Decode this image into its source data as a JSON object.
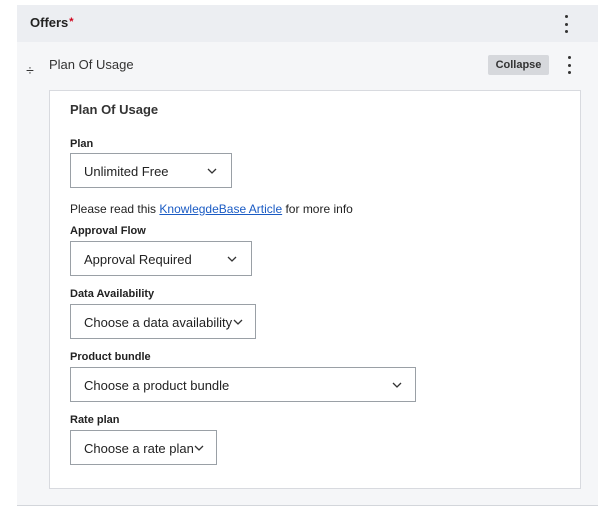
{
  "offers": {
    "title": "Offers",
    "required_mark": "*"
  },
  "item": {
    "header_label": "Plan Of Usage",
    "collapse_label": "Collapse"
  },
  "card": {
    "title": "Plan Of Usage",
    "plan": {
      "label": "Plan",
      "value": "Unlimited Free"
    },
    "info": {
      "prefix": "Please read this ",
      "link": "KnowlegdeBase Article",
      "suffix": " for more info"
    },
    "approval_flow": {
      "label": "Approval Flow",
      "value": "Approval Required"
    },
    "data_availability": {
      "label": "Data Availability",
      "value": "Choose a data availability"
    },
    "product_bundle": {
      "label": "Product bundle",
      "value": "Choose a product bundle"
    },
    "rate_plan": {
      "label": "Rate plan",
      "value": "Choose a rate plan"
    }
  },
  "icons": {
    "kebab": "vertical-ellipsis-icon",
    "drag": "drag-handle-icon",
    "chevron": "chevron-down-icon"
  },
  "colors": {
    "required": "#d0021b",
    "link": "#1a5bc4",
    "panel_bg": "#f5f6f8"
  }
}
